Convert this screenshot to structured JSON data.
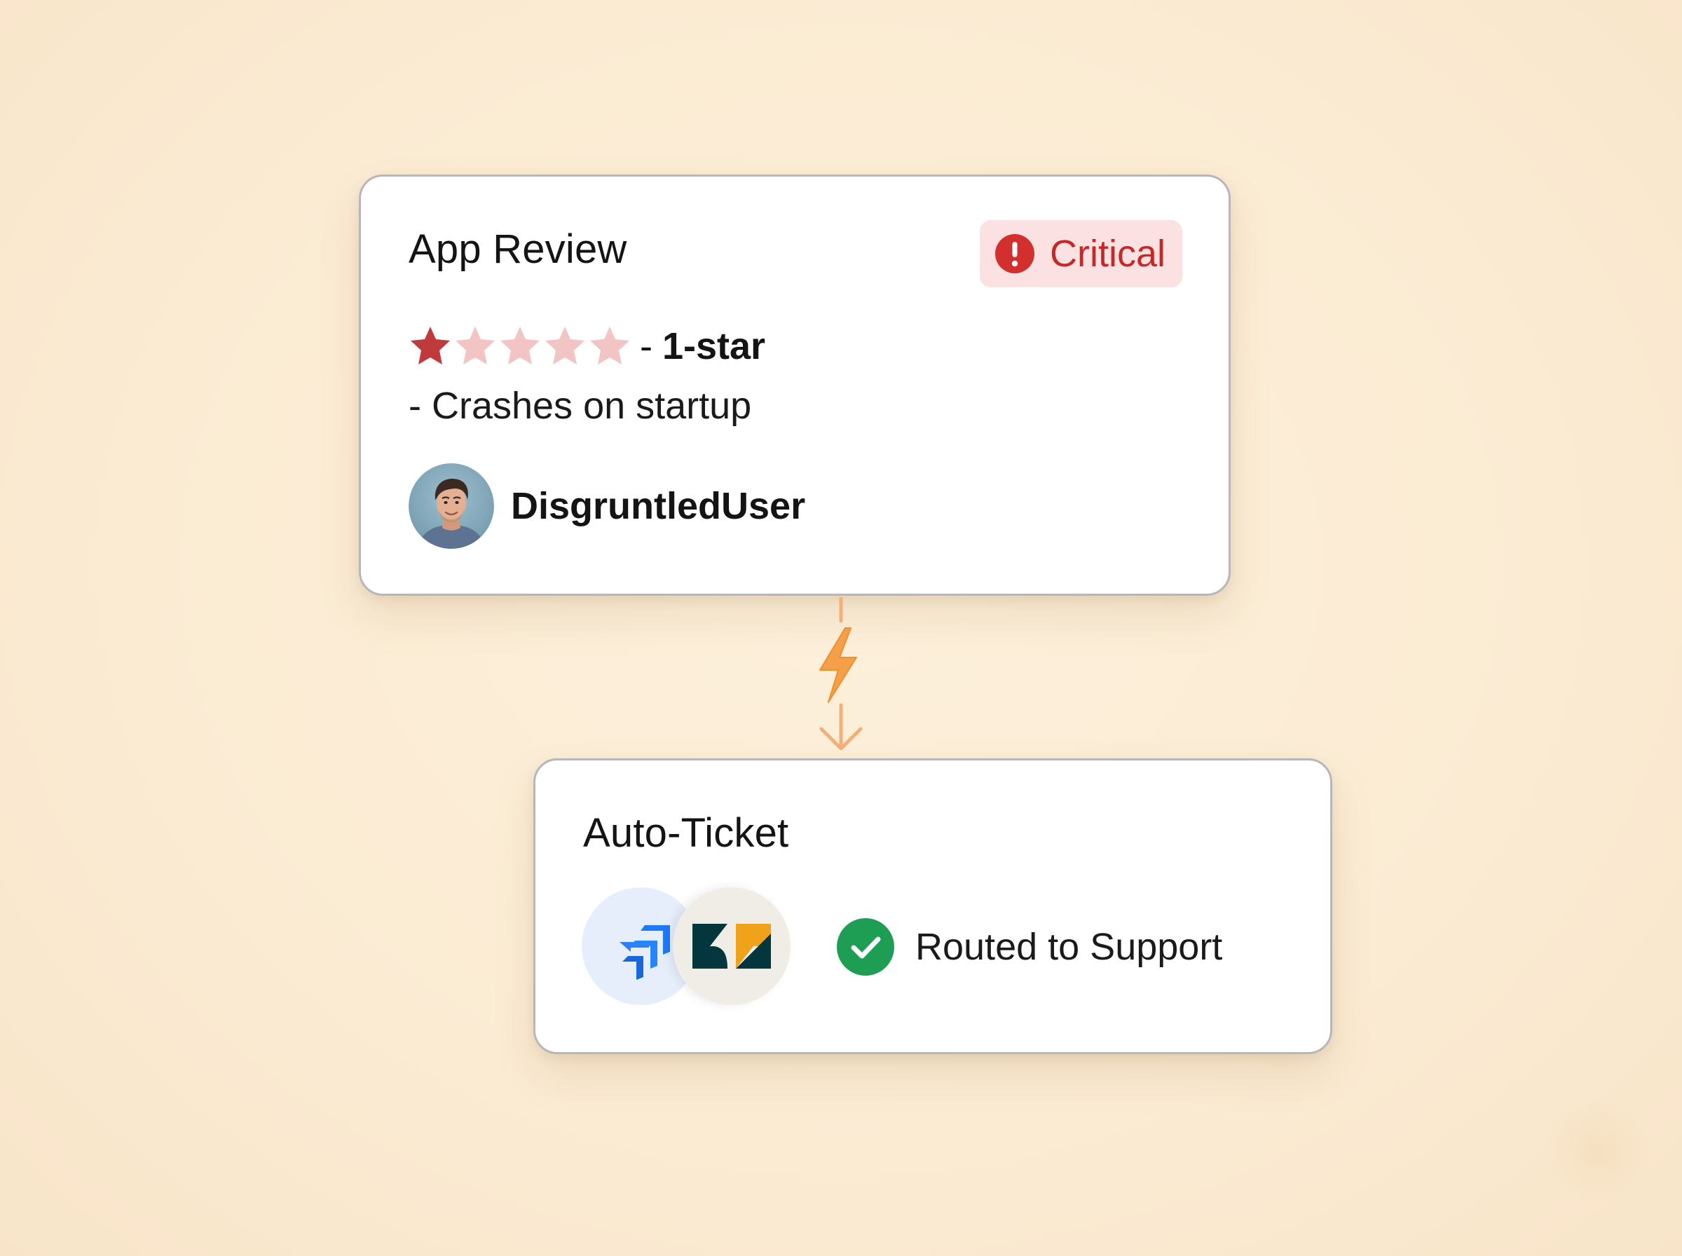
{
  "review_card": {
    "title": "App Review",
    "badge": {
      "label": "Critical",
      "icon": "exclamation-circle-icon",
      "color": "#c62828",
      "background": "#fbe1e1"
    },
    "rating": {
      "stars_filled": 1,
      "stars_total": 5,
      "separator": "-",
      "text": "1-star",
      "filled_color": "#c0393b",
      "empty_color": "#f2c4c4"
    },
    "review_text": "- Crashes on startup",
    "user": {
      "name": "DisgruntledUser",
      "avatar": "user-avatar-photo"
    }
  },
  "connector": {
    "icon": "lightning-bolt-icon",
    "color": "#f4a04a"
  },
  "ticket_card": {
    "title": "Auto-Ticket",
    "integrations": [
      {
        "name": "jira-logo",
        "color": "#2684ff"
      },
      {
        "name": "zendesk-logo",
        "color": "#03363d",
        "accent": "#f1a21b"
      }
    ],
    "status": {
      "icon": "check-circle-icon",
      "color": "#1e9d55",
      "label": "Routed to Support"
    }
  },
  "colors": {
    "background": "#fdf0db",
    "card_border": "#b6b6bc"
  }
}
